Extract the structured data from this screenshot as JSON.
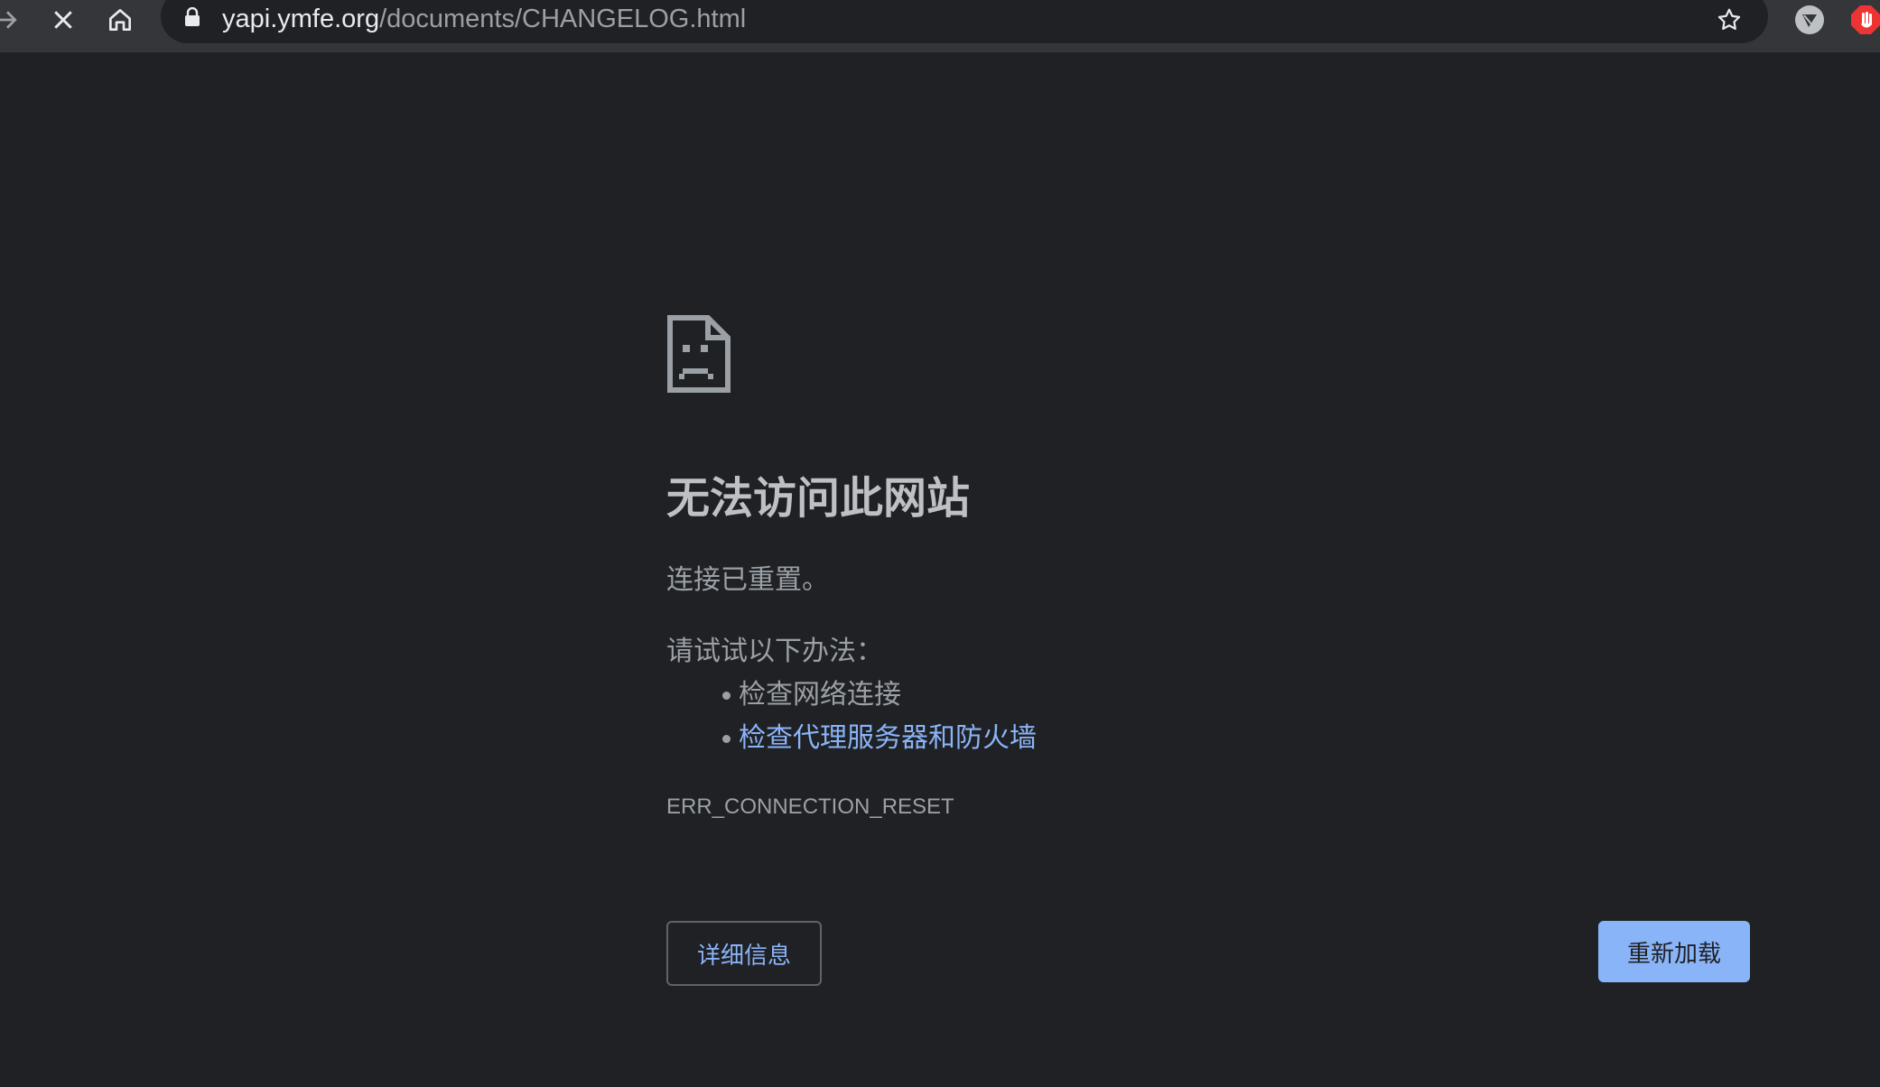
{
  "browser": {
    "url_host": "yapi.ymfe.org",
    "url_path": "/documents/CHANGELOG.html",
    "icons": [
      "forward-arrow-icon",
      "stop-loading-icon",
      "home-icon",
      "lock-icon",
      "bookmark-star-icon",
      "extension-icon",
      "adblock-extension-icon"
    ]
  },
  "error_page": {
    "icon": "sad-document-icon",
    "title": "无法访问此网站",
    "message": "连接已重置。",
    "suggestions_heading": "请试试以下办法：",
    "suggestions": [
      {
        "label": "检查网络连接",
        "is_link": false
      },
      {
        "label": "检查代理服务器和防火墙",
        "is_link": true
      }
    ],
    "error_code": "ERR_CONNECTION_RESET",
    "details_button": "详细信息",
    "reload_button": "重新加载"
  },
  "colors": {
    "background": "#202124",
    "toolbar": "#35363a",
    "text_primary": "#bdc1c6",
    "text_secondary": "#9aa0a6",
    "link": "#8ab4f8",
    "button_primary": "#8ab4f8"
  }
}
